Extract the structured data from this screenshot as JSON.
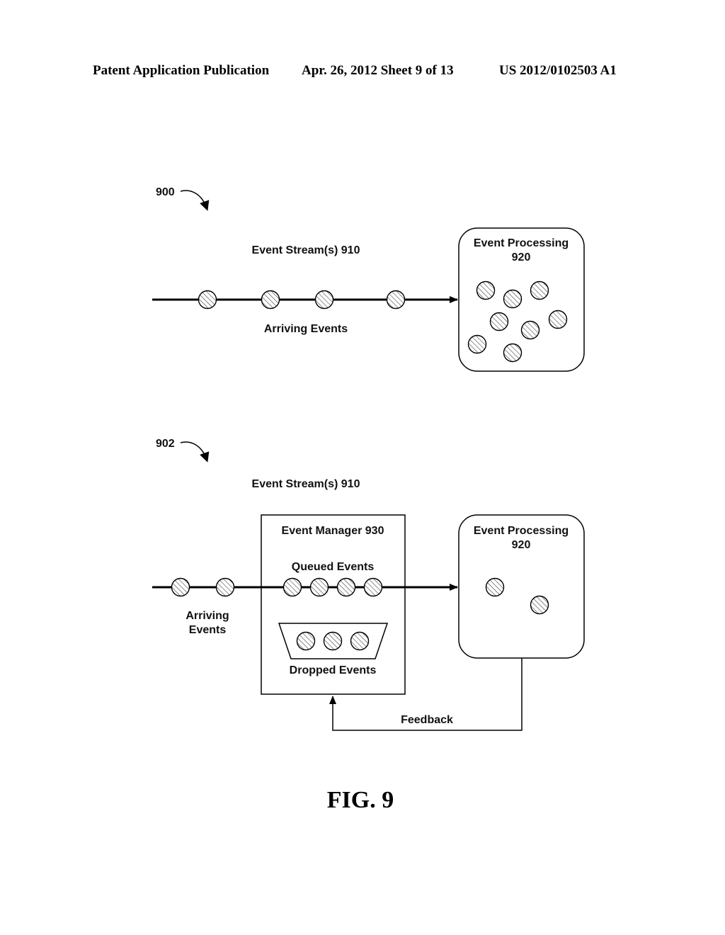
{
  "header": {
    "publication": "Patent Application Publication",
    "date_sheet": "Apr. 26, 2012  Sheet 9 of 13",
    "patent_number": "US 2012/0102503 A1"
  },
  "diagram_900": {
    "ref": "900",
    "stream_label": "Event Stream(s) 910",
    "arriving_label": "Arriving Events",
    "processing_label_line1": "Event Processing",
    "processing_label_line2": "920",
    "arriving_event_count": 4,
    "processed_event_count": 8
  },
  "diagram_902": {
    "ref": "902",
    "stream_label": "Event Stream(s) 910",
    "arriving_label_line1": "Arriving",
    "arriving_label_line2": "Events",
    "manager_label": "Event Manager 930",
    "queued_label": "Queued Events",
    "dropped_label": "Dropped Events",
    "processing_label_line1": "Event Processing",
    "processing_label_line2": "920",
    "feedback_label": "Feedback",
    "arriving_event_count": 2,
    "queued_event_count": 4,
    "dropped_event_count": 3,
    "processed_event_count": 2
  },
  "figure_label": "FIG. 9"
}
